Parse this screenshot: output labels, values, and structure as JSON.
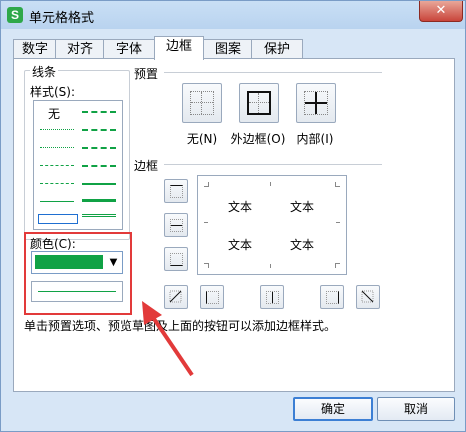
{
  "window": {
    "title": "单元格格式",
    "app_icon_letter": "S",
    "close_symbol": "✕"
  },
  "tabs": [
    {
      "label": "数字"
    },
    {
      "label": "对齐"
    },
    {
      "label": "字体"
    },
    {
      "label": "边框",
      "active": true
    },
    {
      "label": "图案"
    },
    {
      "label": "保护"
    }
  ],
  "lines": {
    "group_label": "线条",
    "style_label": "样式(S):",
    "none_label": "无",
    "color_label": "颜色(C):",
    "selected_color": "#10a245"
  },
  "presets": {
    "title": "预置",
    "items": [
      {
        "label": "无(N)"
      },
      {
        "label": "外边框(O)"
      },
      {
        "label": "内部(I)"
      }
    ]
  },
  "border": {
    "title": "边框",
    "preview_texts": [
      "文本",
      "文本",
      "文本",
      "文本"
    ]
  },
  "hint": "单击预置选项、预览草图及上面的按钮可以添加边框样式。",
  "buttons": {
    "ok": "确定",
    "cancel": "取消"
  },
  "colors": {
    "accent_green": "#10a245",
    "highlight_red": "#e23a3a"
  }
}
